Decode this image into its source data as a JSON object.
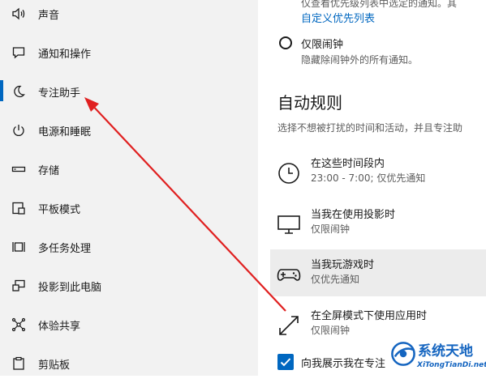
{
  "sidebar": {
    "items": [
      {
        "label": "声音",
        "icon": "speaker-icon",
        "selected": false
      },
      {
        "label": "通知和操作",
        "icon": "notification-icon",
        "selected": false
      },
      {
        "label": "专注助手",
        "icon": "moon-icon",
        "selected": true
      },
      {
        "label": "电源和睡眠",
        "icon": "power-icon",
        "selected": false
      },
      {
        "label": "存储",
        "icon": "storage-icon",
        "selected": false
      },
      {
        "label": "平板模式",
        "icon": "tablet-mode-icon",
        "selected": false
      },
      {
        "label": "多任务处理",
        "icon": "multitasking-icon",
        "selected": false
      },
      {
        "label": "投影到此电脑",
        "icon": "project-icon",
        "selected": false
      },
      {
        "label": "体验共享",
        "icon": "shared-experiences-icon",
        "selected": false
      },
      {
        "label": "剪贴板",
        "icon": "clipboard-icon",
        "selected": false
      }
    ]
  },
  "main": {
    "top_desc": "仅查看优先级列表中选定的通知。其",
    "priority_link": "自定义优先列表",
    "alarms_only": {
      "label": "仅限闹钟",
      "desc": "隐藏除闹钟外的所有通知。"
    },
    "auto_rules": {
      "heading": "自动规则",
      "desc": "选择不想被打扰的时间和活动，并且专注助"
    },
    "rules": [
      {
        "title": "在这些时间段内",
        "sub": "23:00 - 7:00; 仅优先通知",
        "icon": "clock-icon"
      },
      {
        "title": "当我在使用投影时",
        "sub": "仅限闹钟",
        "icon": "monitor-icon"
      },
      {
        "title": "当我玩游戏时",
        "sub": "仅优先通知",
        "icon": "gamepad-icon"
      },
      {
        "title": "在全屏模式下使用应用时",
        "sub": "仅限闹钟",
        "icon": "fullscreen-icon"
      }
    ],
    "checkbox": {
      "label": "向我展示我在专注",
      "checked": true
    }
  },
  "watermark": {
    "text": "系统天地",
    "url": "XiTongTianDi.net"
  },
  "colors": {
    "accent": "#0067c0",
    "arrow": "#e02020",
    "sidebar_bg": "#f2f2f2"
  }
}
